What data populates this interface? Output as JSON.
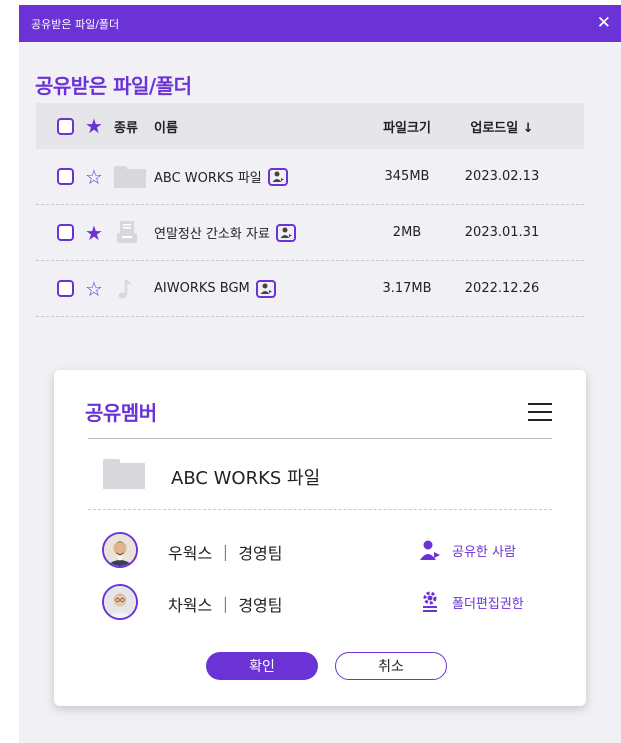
{
  "window": {
    "title": "공유받은 파일/폴더",
    "close_glyph": "✕"
  },
  "heading": "공유받은 파일/폴더",
  "table": {
    "headers": {
      "kind": "종류",
      "name": "이름",
      "size": "파일크기",
      "date": "업로드일 ↓"
    },
    "rows": [
      {
        "starred": false,
        "icon": "folder-icon",
        "name": "ABC WORKS 파일",
        "size": "345MB",
        "date": "2023.02.13"
      },
      {
        "starred": true,
        "icon": "document-icon",
        "name": "연말정산 간소화 자료",
        "size": "2MB",
        "date": "2023.01.31"
      },
      {
        "starred": false,
        "icon": "music-note-icon",
        "name": "AIWORKS BGM",
        "size": "3.17MB",
        "date": "2022.12.26"
      }
    ]
  },
  "modal": {
    "title": "공유멤버",
    "folder_name": "ABC WORKS 파일",
    "members": [
      {
        "name": "우웍스 ｜ 경영팀",
        "action": "공유한 사람",
        "action_icon": "user-share-icon"
      },
      {
        "name": "차웍스 ｜ 경영팀",
        "action": "폴더편집권한",
        "action_icon": "settings-user-icon"
      }
    ],
    "confirm_label": "확인",
    "cancel_label": "취소"
  },
  "colors": {
    "accent": "#6b33d6",
    "panel": "#f1f1f5",
    "header": "#e5e5ea",
    "icon_gray": "#d8d8dc"
  }
}
